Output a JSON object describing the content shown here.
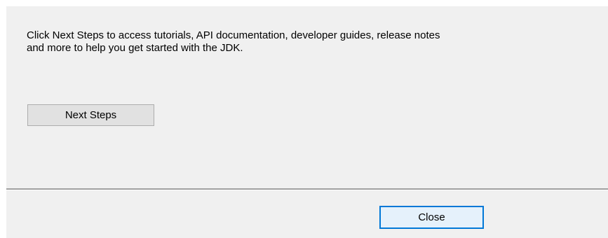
{
  "dialog": {
    "message_line1": "Click Next Steps to access tutorials, API documentation, developer guides, release notes",
    "message_line2": "and more to help you get started with the JDK.",
    "next_steps_label": "Next Steps",
    "close_label": "Close"
  },
  "colors": {
    "panel_background": "#f0f0f0",
    "button_background": "#e1e1e1",
    "focused_button_border": "#0078d7"
  }
}
